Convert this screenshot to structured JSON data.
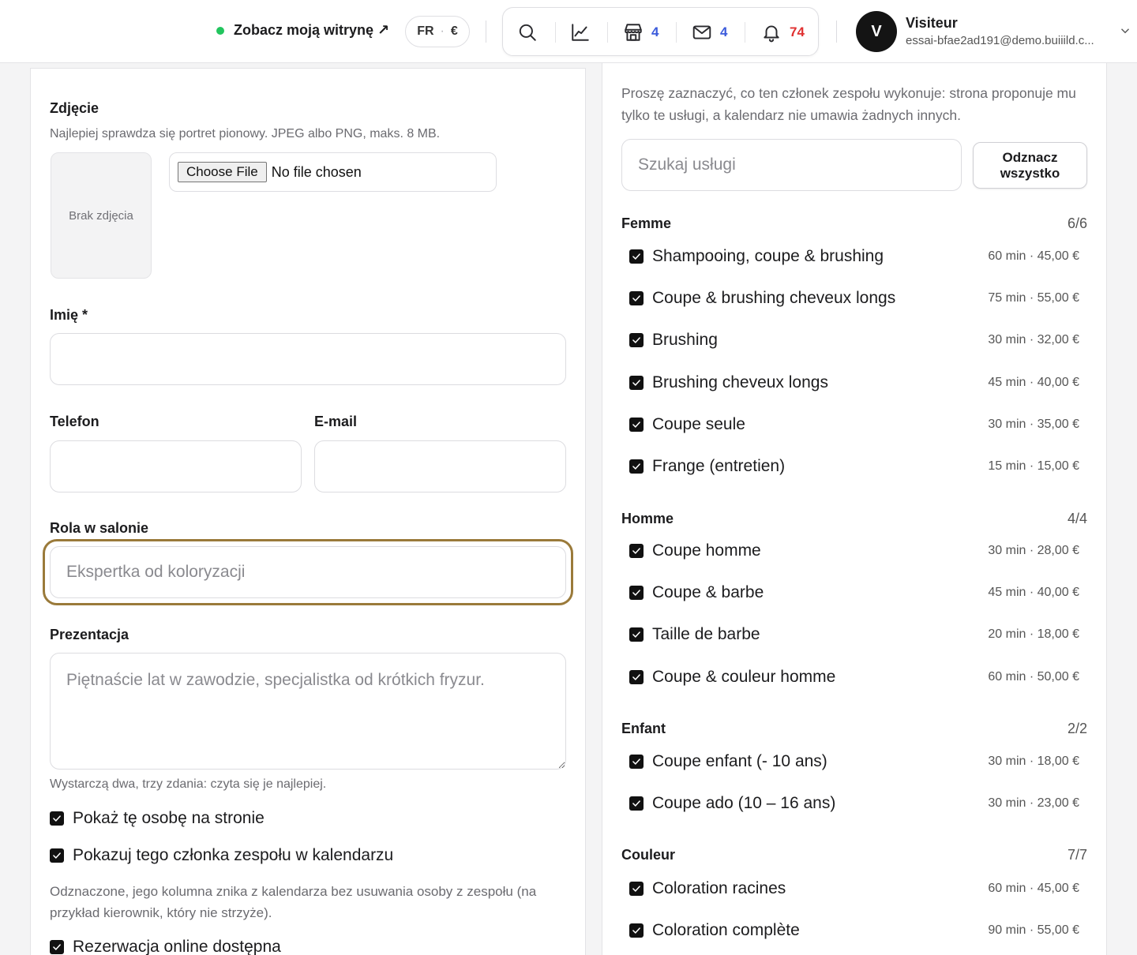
{
  "header": {
    "site_link": "Zobacz moją witrynę ↗",
    "locale_lang": "FR",
    "locale_sep": "·",
    "locale_currency": "€",
    "counts": {
      "bookings": "4",
      "messages": "4",
      "notifications": "74"
    },
    "user": {
      "initial": "V",
      "name": "Visiteur",
      "email": "essai-bfae2ad191@demo.buiiild.c..."
    },
    "colors": {
      "online_dot": "#22c55e",
      "count_blue": "#3b5bdb",
      "count_red": "#e03131"
    }
  },
  "form": {
    "photo": {
      "label": "Zdjęcie",
      "help": "Najlepiej sprawdza się portret pionowy. JPEG albo PNG, maks. 8 MB.",
      "placeholder": "Brak zdjęcia",
      "choose_label": "Choose File",
      "file_status": "No file chosen"
    },
    "first_name": {
      "label": "Imię *",
      "value": ""
    },
    "phone": {
      "label": "Telefon",
      "value": ""
    },
    "email": {
      "label": "E-mail",
      "value": ""
    },
    "role": {
      "label": "Rola w salonie",
      "placeholder": "Ekspertka od koloryzacji"
    },
    "bio": {
      "label": "Prezentacja",
      "placeholder": "Piętnaście lat w zawodzie, specjalistka od krótkich fryzur.",
      "help": "Wystarczą dwa, trzy zdania: czyta się je najlepiej."
    },
    "show_on_site": {
      "label": "Pokaż tę osobę na stronie",
      "checked": true
    },
    "show_in_calendar": {
      "label": "Pokazuj tego członka zespołu w kalendarzu",
      "checked": true
    },
    "calendar_help": "Odznaczone, jego kolumna znika z kalendarza bez usuwania osoby z zespołu (na przykład kierownik, który nie strzyże).",
    "online_booking": {
      "label": "Rezerwacja online dostępna",
      "checked": true
    },
    "focus_color": "#9a7a3a"
  },
  "services": {
    "intro": "Proszę zaznaczyć, co ten członek zespołu wykonuje: strona proponuje mu tylko te usługi, a kalendarz nie umawia żadnych innych.",
    "search_placeholder": "Szukaj usługi",
    "deselect_label": "Odznacz wszystko",
    "categories": [
      {
        "name": "Femme",
        "count": "6/6",
        "items": [
          {
            "name": "Shampooing, coupe & brushing",
            "meta": "60 min · 45,00 €"
          },
          {
            "name": "Coupe & brushing cheveux longs",
            "meta": "75 min · 55,00 €"
          },
          {
            "name": "Brushing",
            "meta": "30 min · 32,00 €"
          },
          {
            "name": "Brushing cheveux longs",
            "meta": "45 min · 40,00 €"
          },
          {
            "name": "Coupe seule",
            "meta": "30 min · 35,00 €"
          },
          {
            "name": "Frange (entretien)",
            "meta": "15 min · 15,00 €"
          }
        ]
      },
      {
        "name": "Homme",
        "count": "4/4",
        "items": [
          {
            "name": "Coupe homme",
            "meta": "30 min · 28,00 €"
          },
          {
            "name": "Coupe & barbe",
            "meta": "45 min · 40,00 €"
          },
          {
            "name": "Taille de barbe",
            "meta": "20 min · 18,00 €"
          },
          {
            "name": "Coupe & couleur homme",
            "meta": "60 min · 50,00 €"
          }
        ]
      },
      {
        "name": "Enfant",
        "count": "2/2",
        "items": [
          {
            "name": "Coupe enfant (- 10 ans)",
            "meta": "30 min · 18,00 €"
          },
          {
            "name": "Coupe ado (10 – 16 ans)",
            "meta": "30 min · 23,00 €"
          }
        ]
      },
      {
        "name": "Couleur",
        "count": "7/7",
        "items": [
          {
            "name": "Coloration racines",
            "meta": "60 min · 45,00 €"
          },
          {
            "name": "Coloration complète",
            "meta": "90 min · 55,00 €"
          }
        ]
      }
    ]
  }
}
